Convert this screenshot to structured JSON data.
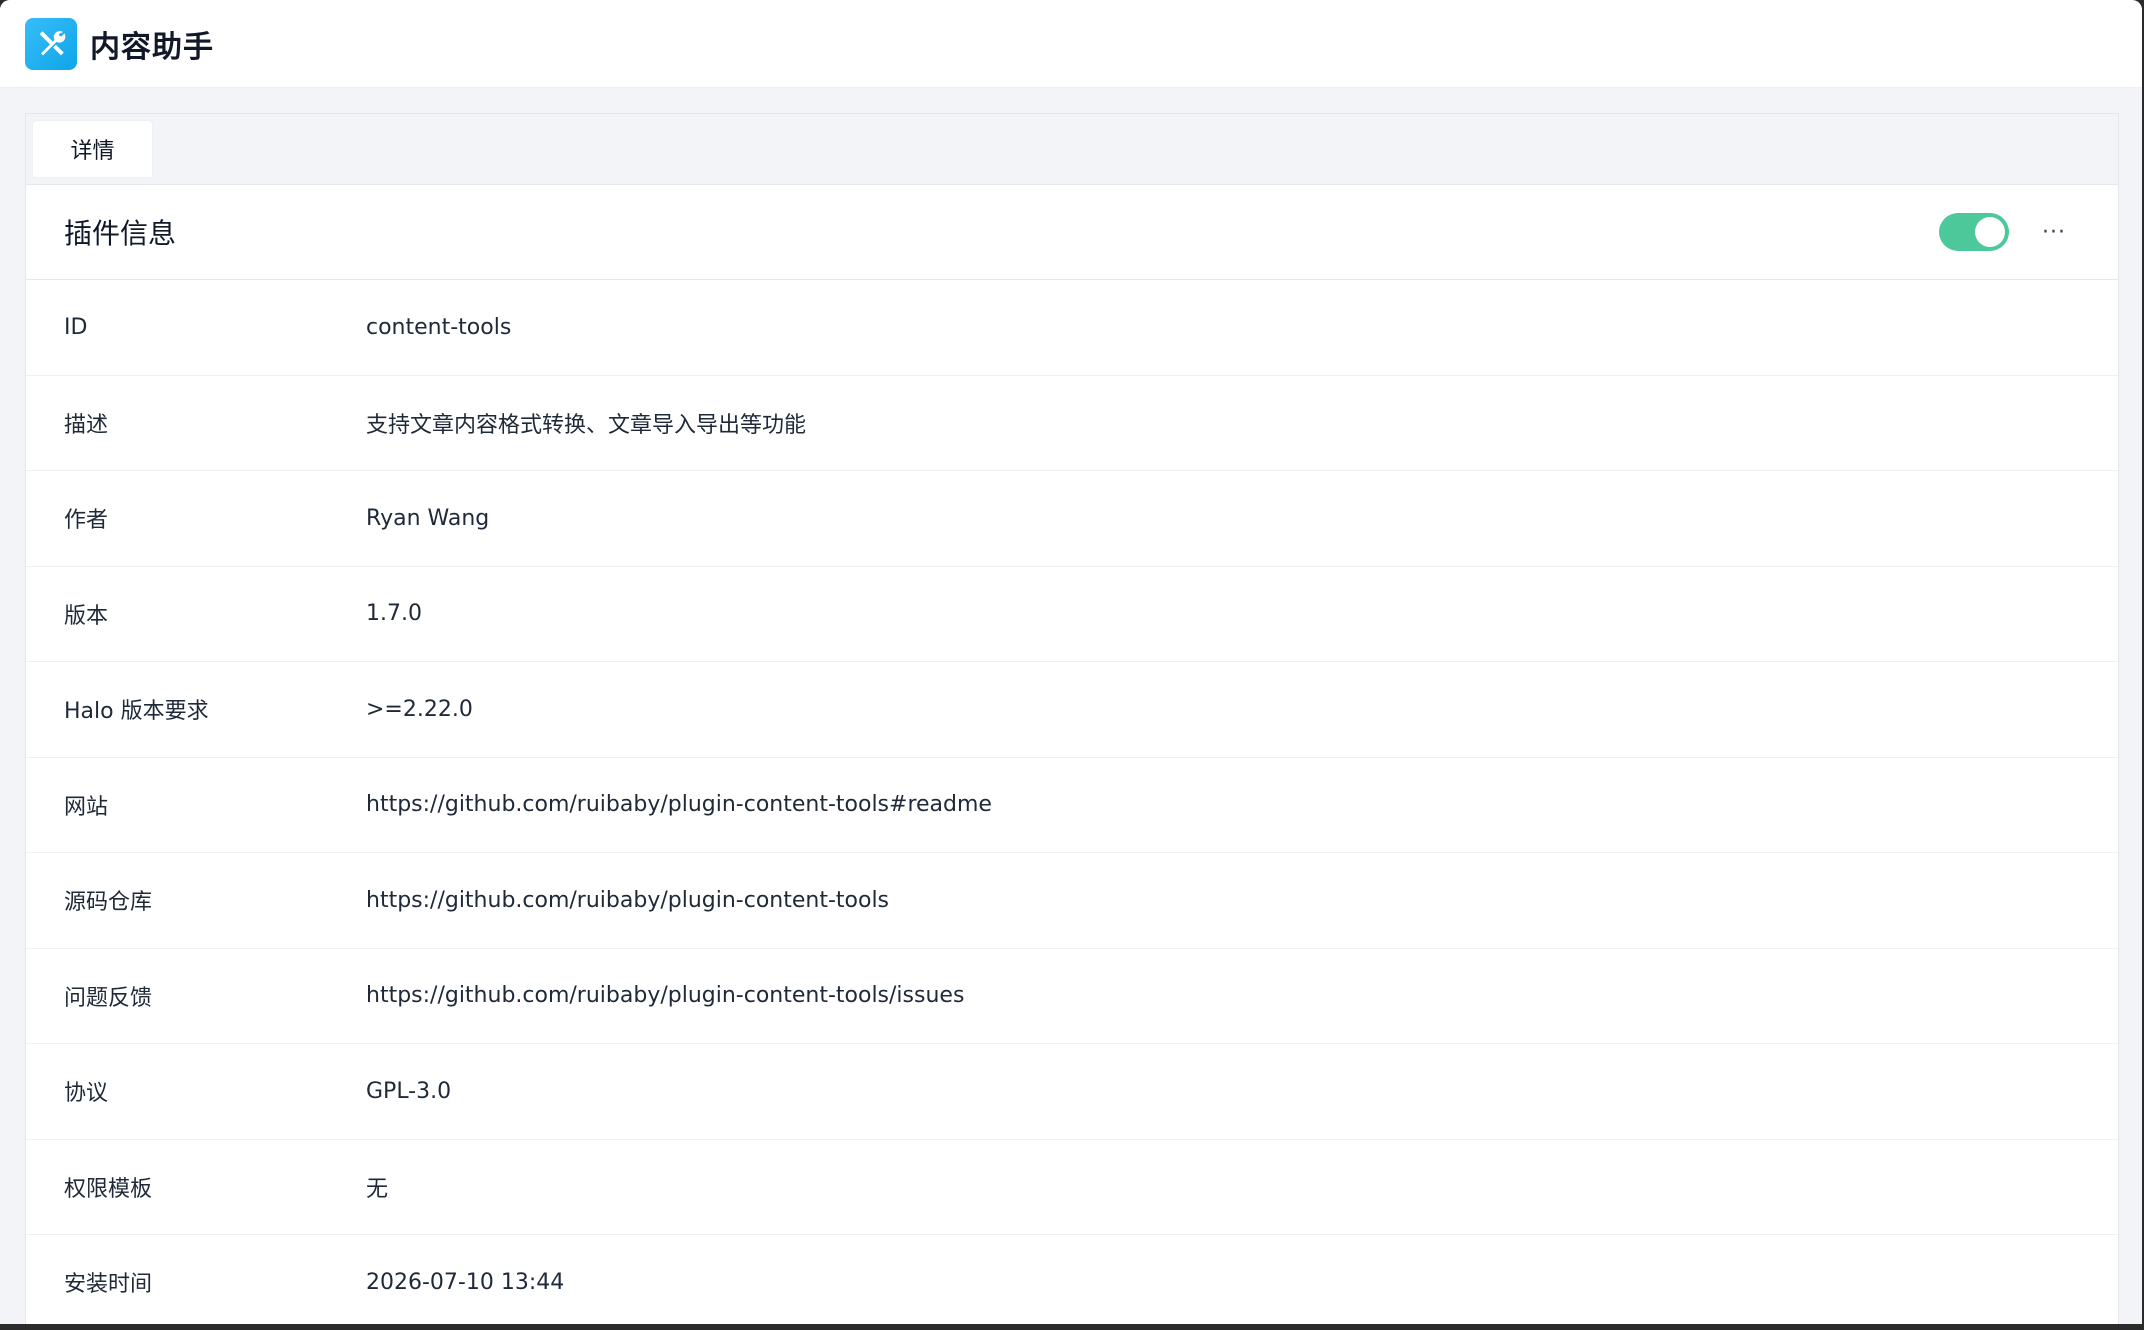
{
  "header": {
    "app_title": "内容助手",
    "logo_icon": "tools-icon",
    "logo_color": "#0ea5e9"
  },
  "tabs": [
    {
      "label": "详情",
      "active": true
    }
  ],
  "section": {
    "title": "插件信息",
    "enabled": true,
    "toggle_color": "#4cc89a",
    "more_label": "···"
  },
  "details": [
    {
      "label": "ID",
      "value": "content-tools"
    },
    {
      "label": "描述",
      "value": "支持文章内容格式转换、文章导入导出等功能"
    },
    {
      "label": "作者",
      "value": "Ryan Wang"
    },
    {
      "label": "版本",
      "value": "1.7.0"
    },
    {
      "label": "Halo 版本要求",
      "value": ">=2.22.0"
    },
    {
      "label": "网站",
      "value": "https://github.com/ruibaby/plugin-content-tools#readme"
    },
    {
      "label": "源码仓库",
      "value": "https://github.com/ruibaby/plugin-content-tools"
    },
    {
      "label": "问题反馈",
      "value": "https://github.com/ruibaby/plugin-content-tools/issues"
    },
    {
      "label": "协议",
      "value": "GPL-3.0"
    },
    {
      "label": "权限模板",
      "value": "无"
    },
    {
      "label": "安装时间",
      "value": "2026-07-10 13:44"
    }
  ]
}
